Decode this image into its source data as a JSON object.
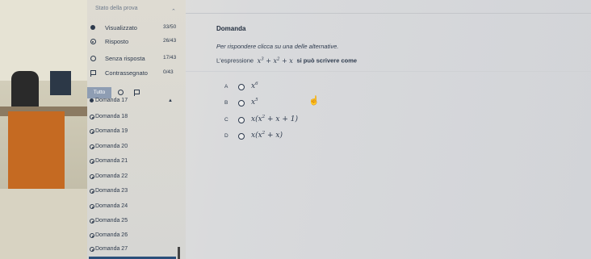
{
  "sidebar": {
    "title": "Stato della prova",
    "stats": [
      {
        "label": "Visualizzato",
        "count": "33/50",
        "icon": "filled-dot-icon"
      },
      {
        "label": "Risposto",
        "count": "26/43",
        "icon": "target-dot-icon"
      },
      {
        "label": "Senza risposta",
        "count": "17/43",
        "icon": "empty-circle-icon"
      },
      {
        "label": "Contrassegnato",
        "count": "0/43",
        "icon": "flag-icon"
      }
    ],
    "filter_all_label": "Tutto",
    "questions": [
      "Domanda 17",
      "Domanda 18",
      "Domanda 19",
      "Domanda 20",
      "Domanda 21",
      "Domanda 22",
      "Domanda 23",
      "Domanda 24",
      "Domanda 25",
      "Domanda 26",
      "Domanda 27"
    ]
  },
  "main": {
    "question_title": "Domanda",
    "instruction": "Per rispondere clicca su una delle alternative.",
    "stem_prefix": "L'espressione",
    "stem_suffix": "si può scrivere come",
    "options": [
      {
        "letter": "A"
      },
      {
        "letter": "B"
      },
      {
        "letter": "C"
      },
      {
        "letter": "D"
      }
    ]
  }
}
